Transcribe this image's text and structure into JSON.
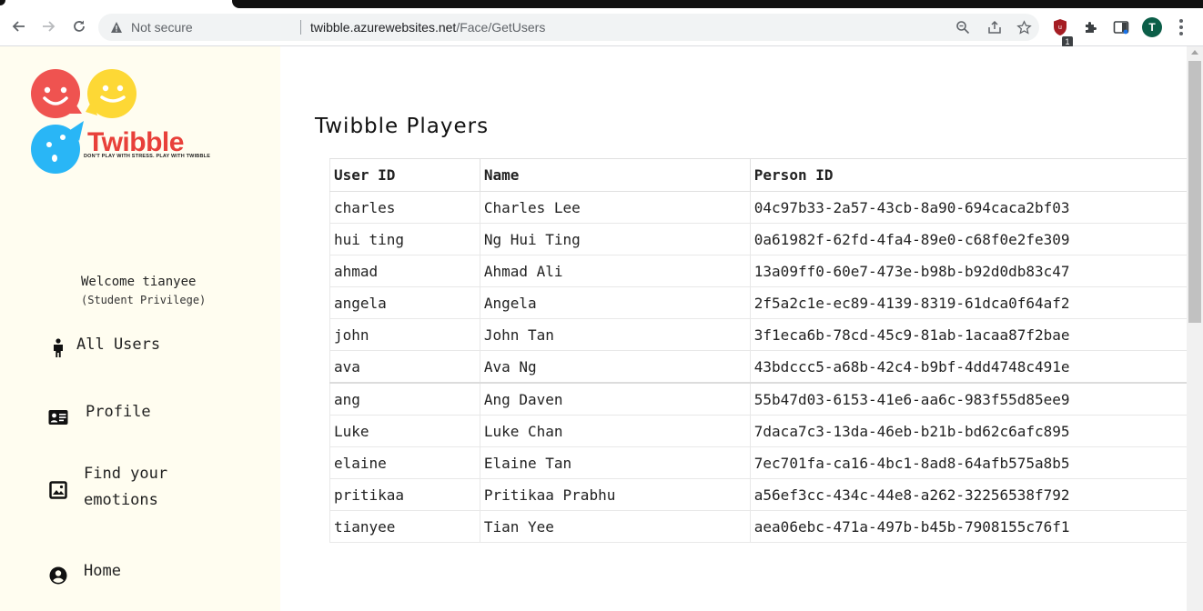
{
  "browser": {
    "security_label": "Not secure",
    "url_host": "twibble.azurewebsites.net",
    "url_path": "/Face/GetUsers",
    "profile_initial": "T",
    "extension_badge": "1"
  },
  "brand": {
    "name": "Twibble",
    "tagline": "DON'T PLAY WITH STRESS. PLAY WITH TWIBBLE",
    "colors": {
      "red": "#ef5350",
      "yellow": "#fdd835",
      "blue": "#29b6f6",
      "wordmark": "#e8403a"
    }
  },
  "sidebar": {
    "welcome": "Welcome tianyee",
    "privilege": "(Student Privilege)",
    "items": [
      {
        "label": "All Users",
        "icon": "person-icon"
      },
      {
        "label": "Profile",
        "icon": "id-card-icon"
      },
      {
        "label": "Find your\nemotions",
        "icon": "image-icon"
      },
      {
        "label": "Home",
        "icon": "account-circle-icon"
      }
    ]
  },
  "main": {
    "title": "Twibble Players",
    "columns": [
      "User ID",
      "Name",
      "Person ID"
    ],
    "rows": [
      [
        "charles",
        "Charles Lee",
        "04c97b33-2a57-43cb-8a90-694caca2bf03"
      ],
      [
        "hui ting",
        "Ng Hui Ting",
        "0a61982f-62fd-4fa4-89e0-c68f0e2fe309"
      ],
      [
        "ahmad",
        "Ahmad Ali",
        "13a09ff0-60e7-473e-b98b-b92d0db83c47"
      ],
      [
        "angela",
        "Angela",
        "2f5a2c1e-ec89-4139-8319-61dca0f64af2"
      ],
      [
        "john",
        "John Tan",
        "3f1eca6b-78cd-45c9-81ab-1acaa87f2bae"
      ],
      [
        "ava",
        "Ava Ng",
        "43bdccc5-a68b-42c4-b9bf-4dd4748c491e"
      ],
      [
        "ang",
        "Ang Daven",
        "55b47d03-6153-41e6-aa6c-983f55d85ee9"
      ],
      [
        "Luke",
        "Luke Chan",
        "7daca7c3-13da-46eb-b21b-bd62c6afc895"
      ],
      [
        "elaine",
        "Elaine Tan",
        "7ec701fa-ca16-4bc1-8ad8-64afb575a8b5"
      ],
      [
        "pritikaa",
        "Pritikaa Prabhu",
        "a56ef3cc-434c-44e8-a262-32256538f792"
      ],
      [
        "tianyee",
        "Tian Yee",
        "aea06ebc-471a-497b-b45b-7908155c76f1"
      ]
    ]
  }
}
